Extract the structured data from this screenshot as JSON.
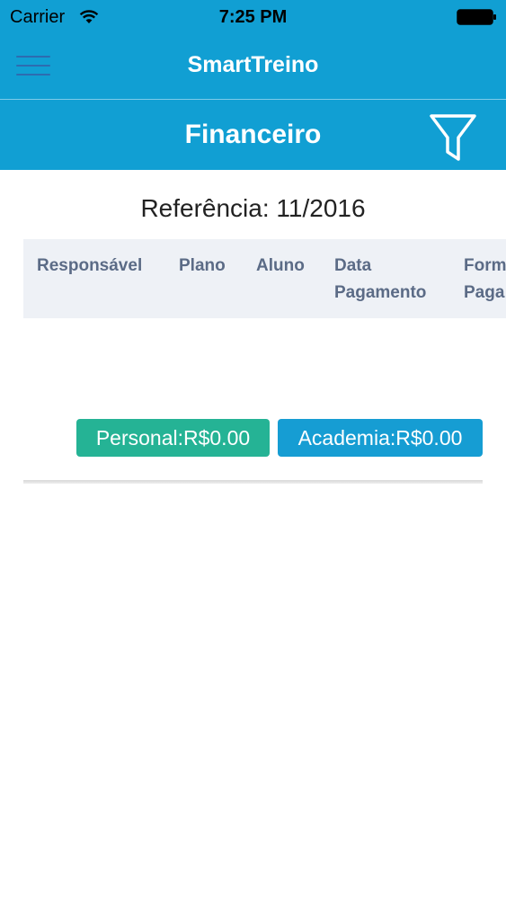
{
  "status_bar": {
    "carrier": "Carrier",
    "time": "7:25 PM",
    "wifi_icon": "wifi-icon",
    "battery_icon": "battery-icon"
  },
  "nav": {
    "menu_icon": "hamburger-menu-icon",
    "title": "SmartTreino"
  },
  "section": {
    "title": "Financeiro",
    "filter_icon": "filter-icon"
  },
  "reference": "Referência: 11/2016",
  "table": {
    "headers": [
      {
        "line1": "",
        "line2": "Responsável"
      },
      {
        "line1": "",
        "line2": "Plano"
      },
      {
        "line1": "",
        "line2": "Aluno"
      },
      {
        "line1": "Data",
        "line2": "Pagamento"
      },
      {
        "line1": "Form",
        "line2": "Paga"
      }
    ],
    "totals": {
      "personal": "Personal:R$0.00",
      "academia": "Academia:R$0.00"
    }
  },
  "colors": {
    "primary": "#119fd3",
    "personal_badge": "#25b395",
    "academia_badge": "#169dd3",
    "header_bg": "#eef1f6",
    "header_text": "#5b6b86"
  }
}
